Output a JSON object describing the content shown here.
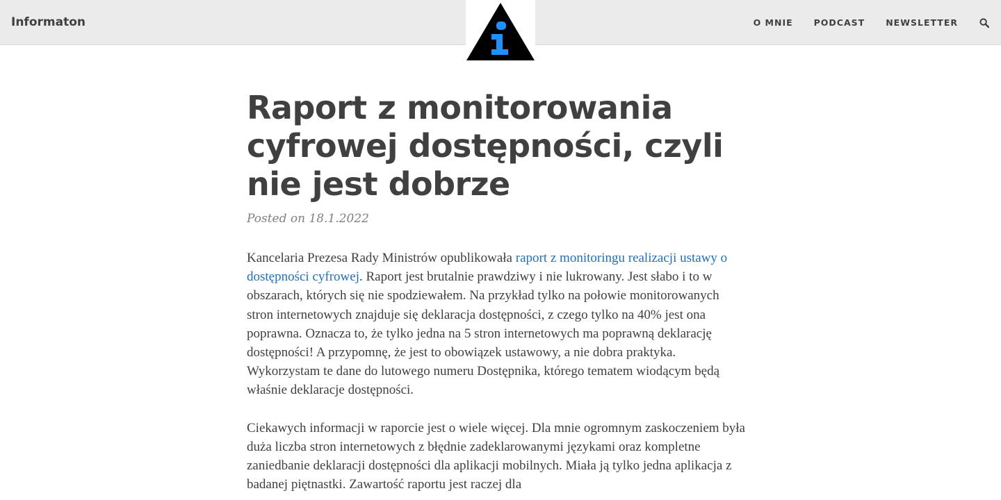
{
  "header": {
    "brand": "Informaton",
    "logo": {
      "icon": "info-warning-triangle-icon",
      "triangle_color": "#000000",
      "letter_color": "#1e90ff"
    },
    "nav": [
      {
        "label": "O MNIE"
      },
      {
        "label": "PODCAST"
      },
      {
        "label": "NEWSLETTER"
      }
    ],
    "search_icon": "search-icon"
  },
  "post": {
    "title": "Raport z monitorowania cyfrowej dostępności, czyli nie jest dobrze",
    "meta": "Posted on 18.1.2022",
    "p1_before": "Kancelaria Prezesa Rady Ministrów opublikowała ",
    "p1_link": "raport z monitoringu realizacji ustawy o dostępności cyfrowej",
    "p1_after": ". Raport jest brutalnie prawdziwy i nie lukrowany. Jest słabo i to w obszarach, których się nie spodziewałem. Na przykład tylko na połowie monitorowanych stron internetowych znajduje się deklaracja dostępności, z czego tylko na 40% jest ona poprawna. Oznacza to, że tylko jedna na 5 stron internetowych ma poprawną deklarację dostępności! A przypomnę, że jest to obowiązek ustawowy, a nie dobra praktyka. Wykorzystam te dane do lutowego numeru Dostępnika, którego tematem wiodącym będą właśnie deklaracje dostępności.",
    "p2": "Ciekawych informacji w raporcie jest o wiele więcej. Dla mnie ogromnym zaskoczeniem była duża liczba stron internetowych z błędnie zadeklarowanymi językami oraz kompletne zaniedbanie deklaracji dostępności dla aplikacji mobilnych. Miała ją tylko jedna aplikacja z badanej piętnastki. Zawartość raportu jest raczej dla"
  },
  "colors": {
    "navbar_bg": "#ebebeb",
    "text": "#404040",
    "meta": "#808080",
    "link": "#1f6fc5"
  }
}
